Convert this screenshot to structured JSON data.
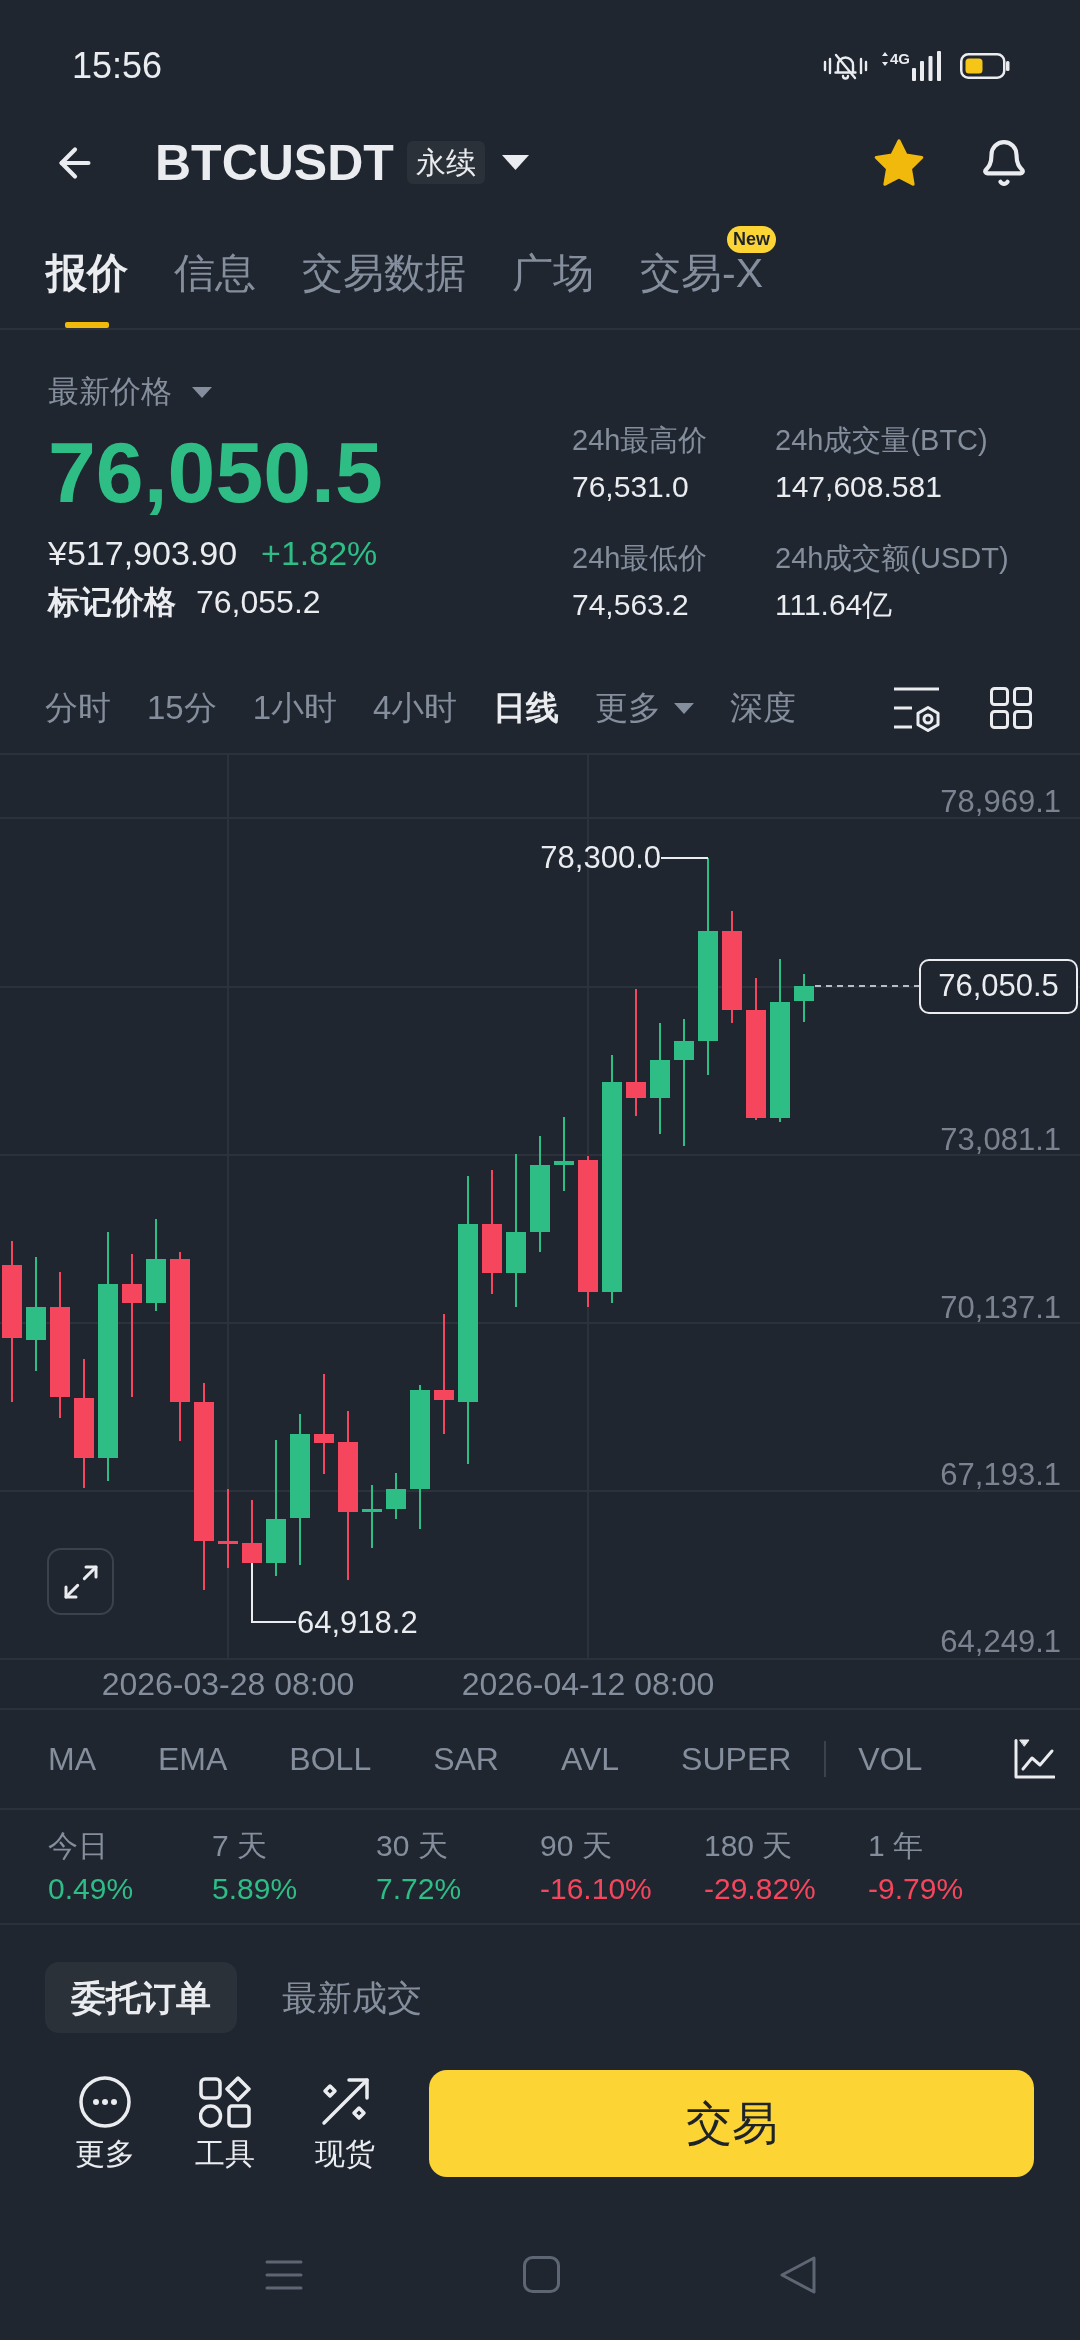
{
  "status_bar": {
    "time": "15:56",
    "network": "4G"
  },
  "header": {
    "symbol": "BTCUSDT",
    "contract_tag": "永续",
    "favorite": true
  },
  "tabs": [
    {
      "label": "报价",
      "selected": true
    },
    {
      "label": "信息",
      "selected": false
    },
    {
      "label": "交易数据",
      "selected": false
    },
    {
      "label": "广场",
      "selected": false
    },
    {
      "label": "交易-X",
      "selected": false,
      "badge": "New"
    }
  ],
  "price": {
    "label": "最新价格",
    "last": "76,050.5",
    "cny": "¥517,903.90",
    "change": "+1.82%",
    "mark_label": "标记价格",
    "mark": "76,055.2"
  },
  "stats": [
    {
      "label": "24h最高价",
      "value": "76,531.0"
    },
    {
      "label": "24h成交量(BTC)",
      "value": "147,608.581"
    },
    {
      "label": "24h最低价",
      "value": "74,563.2"
    },
    {
      "label": "24h成交额(USDT)",
      "value": "111.64亿"
    }
  ],
  "intervals": [
    {
      "label": "分时",
      "kind": "interval",
      "selected": false
    },
    {
      "label": "15分",
      "kind": "interval",
      "selected": false
    },
    {
      "label": "1小时",
      "kind": "interval",
      "selected": false
    },
    {
      "label": "4小时",
      "kind": "interval",
      "selected": false
    },
    {
      "label": "日线",
      "kind": "interval",
      "selected": true
    },
    {
      "label": "更多",
      "kind": "menu",
      "selected": false
    },
    {
      "label": "深度",
      "kind": "interval",
      "selected": false
    }
  ],
  "chart": {
    "y_labels": [
      "78,969.1",
      "73,081.1",
      "70,137.1",
      "67,193.1",
      "64,249.1"
    ],
    "high_label": "78,300.0",
    "low_label": "64,918.2",
    "last_price": "76,050.5",
    "x_labels": [
      "2026-03-28 08:00",
      "2026-04-12 08:00"
    ]
  },
  "indicators": {
    "main": [
      "MA",
      "EMA",
      "BOLL",
      "SAR",
      "AVL",
      "SUPER"
    ],
    "sub": [
      "VOL"
    ]
  },
  "performance": [
    {
      "period": "今日",
      "change": "0.49%",
      "color": "#2ebd85"
    },
    {
      "period": "7 天",
      "change": "5.89%",
      "color": "#2ebd85"
    },
    {
      "period": "30 天",
      "change": "7.72%",
      "color": "#2ebd85"
    },
    {
      "period": "90 天",
      "change": "-16.10%",
      "color": "#f6465d"
    },
    {
      "period": "180 天",
      "change": "-29.82%",
      "color": "#f6465d"
    },
    {
      "period": "1 年",
      "change": "-9.79%",
      "color": "#f6465d"
    }
  ],
  "order_tabs": [
    {
      "label": "委托订单",
      "selected": true
    },
    {
      "label": "最新成交",
      "selected": false
    }
  ],
  "actions": [
    "更多",
    "工具",
    "现货"
  ],
  "trade_button": "交易"
}
